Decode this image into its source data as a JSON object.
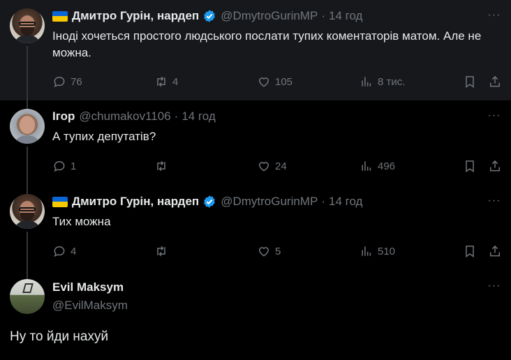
{
  "tweets": [
    {
      "name": "Дмитро Гурін, нардеп",
      "handle": "@DmytroGurinMP",
      "dot": "·",
      "time": "14 год",
      "text": "Іноді хочеться простого людського послати тупих коментаторів матом. Але не можна.",
      "replies": "76",
      "retweets": "4",
      "likes": "105",
      "views": "8 тис."
    },
    {
      "name": "Ігор",
      "handle": "@chumakov1106",
      "dot": "·",
      "time": "14 год",
      "text": "А тупих депутатів?",
      "replies": "1",
      "retweets": "",
      "likes": "24",
      "views": "496"
    },
    {
      "name": "Дмитро Гурін, нардеп",
      "handle": "@DmytroGurinMP",
      "dot": "·",
      "time": "14 год",
      "text": "Тих можна",
      "replies": "4",
      "retweets": "",
      "likes": "5",
      "views": "510"
    }
  ],
  "main_tweet": {
    "name": "Evil Maksym",
    "handle": "@EvilMaksym",
    "text": "Ну то йди нахуй"
  },
  "more_label": "···",
  "colors": {
    "background": "#000000",
    "highlight_background": "#16181c",
    "text": "#e7e9ea",
    "muted": "#71767b",
    "verified": "#1d9bf0",
    "flag_blue": "#0a66d6",
    "flag_yellow": "#f6c800"
  },
  "icons": [
    "reply-icon",
    "retweet-icon",
    "like-icon",
    "views-icon",
    "bookmark-icon",
    "share-icon",
    "verified-badge-icon",
    "ukraine-flag-icon",
    "more-icon"
  ]
}
